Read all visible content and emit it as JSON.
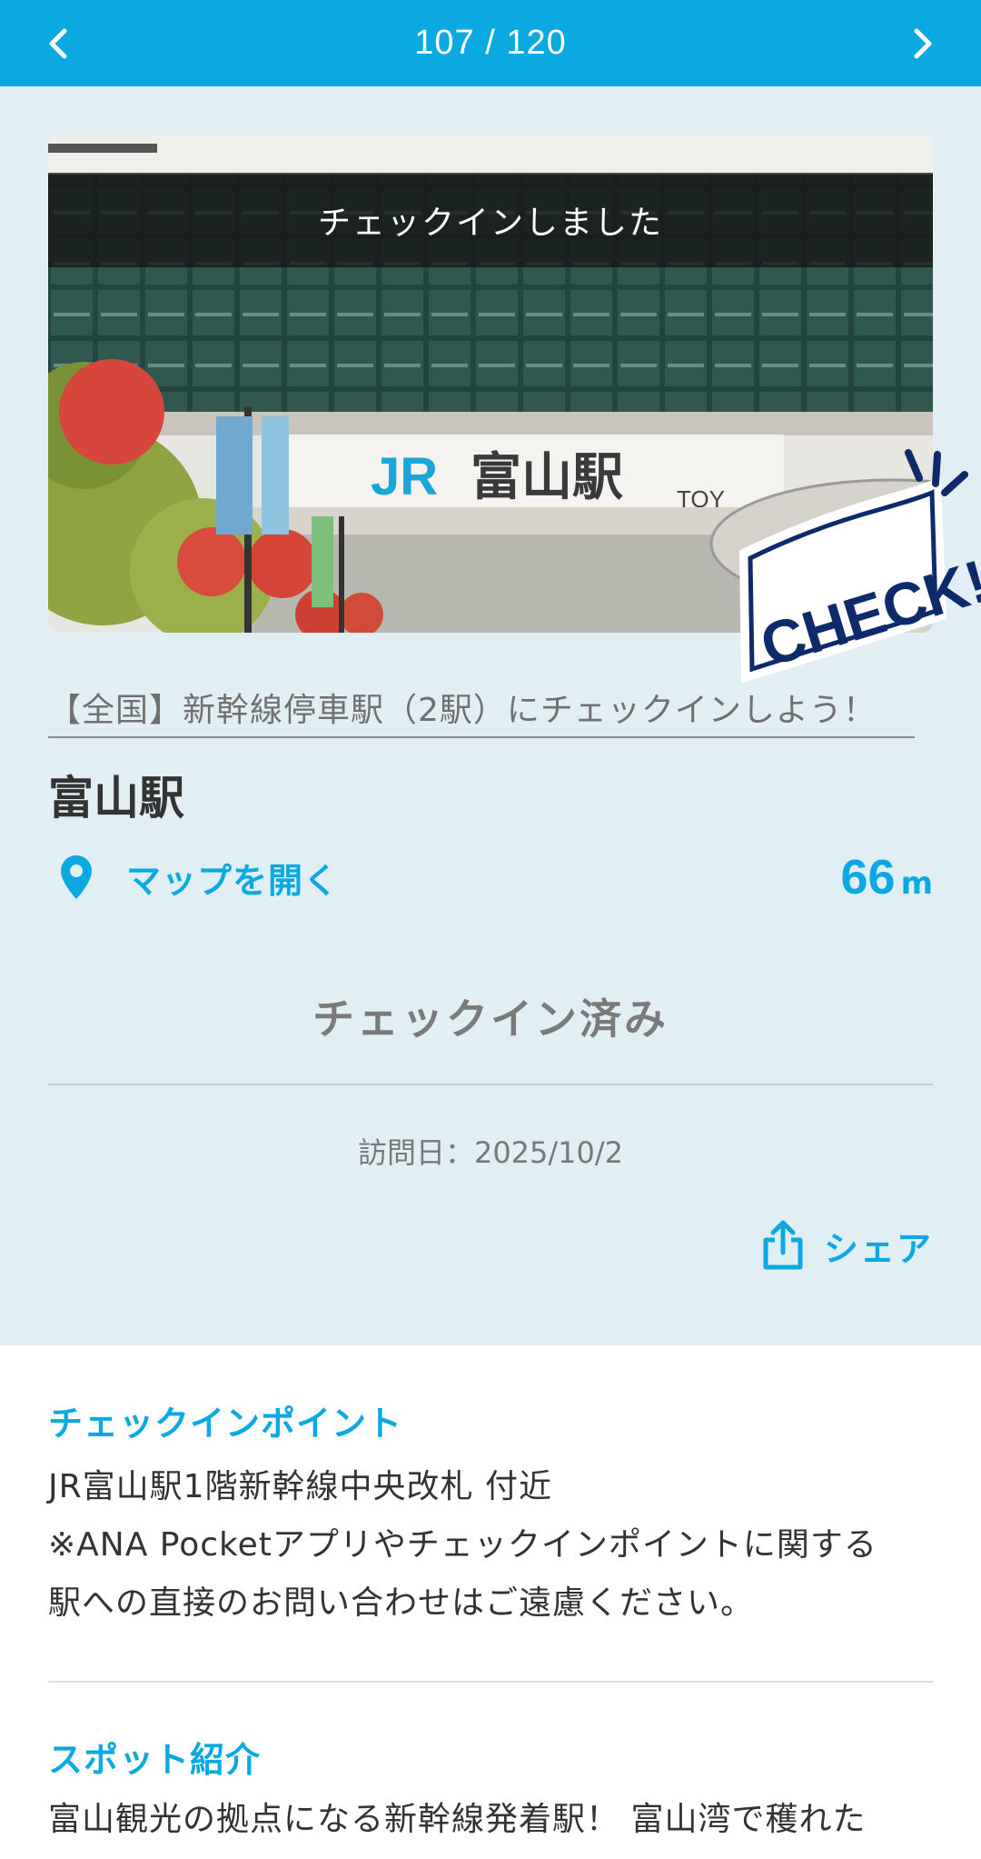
{
  "header": {
    "counter": "107 / 120",
    "prev_icon": "chevron-left-icon",
    "next_icon": "chevron-right-icon",
    "color": "#0aa9e2"
  },
  "photo": {
    "checked_banner": "チェックインしました",
    "station_sign": "富山駅",
    "sign_logo": "JR",
    "sign_partial": "TOY",
    "stamp_text": "CHECK!"
  },
  "campaign": {
    "link_text": "【全国】新幹線停車駅（2駅）にチェックインしよう！"
  },
  "spot": {
    "name": "富山駅",
    "map_label": "マップを開く",
    "map_icon": "map-pin-icon",
    "distance_value": "66",
    "distance_unit": "m"
  },
  "status": {
    "checked_in": "チェックイン済み",
    "visit_date": "訪問日：2025/10/2"
  },
  "share": {
    "label": "シェア",
    "icon": "share-icon"
  },
  "checkin_point": {
    "title": "チェックインポイント",
    "lines": [
      "JR富山駅1階新幹線中央改札 付近",
      "※ANA Pocketアプリやチェックインポイントに関する",
      "駅への直接のお問い合わせはご遠慮ください。"
    ]
  },
  "spot_intro": {
    "title": "スポット紹介",
    "text": "富山観光の拠点になる新幹線発着駅！ 富山湾で穫れた"
  },
  "colors": {
    "accent": "#0aa9e2",
    "background": "#e1eff5",
    "stamp_navy": "#0d2a6b"
  }
}
